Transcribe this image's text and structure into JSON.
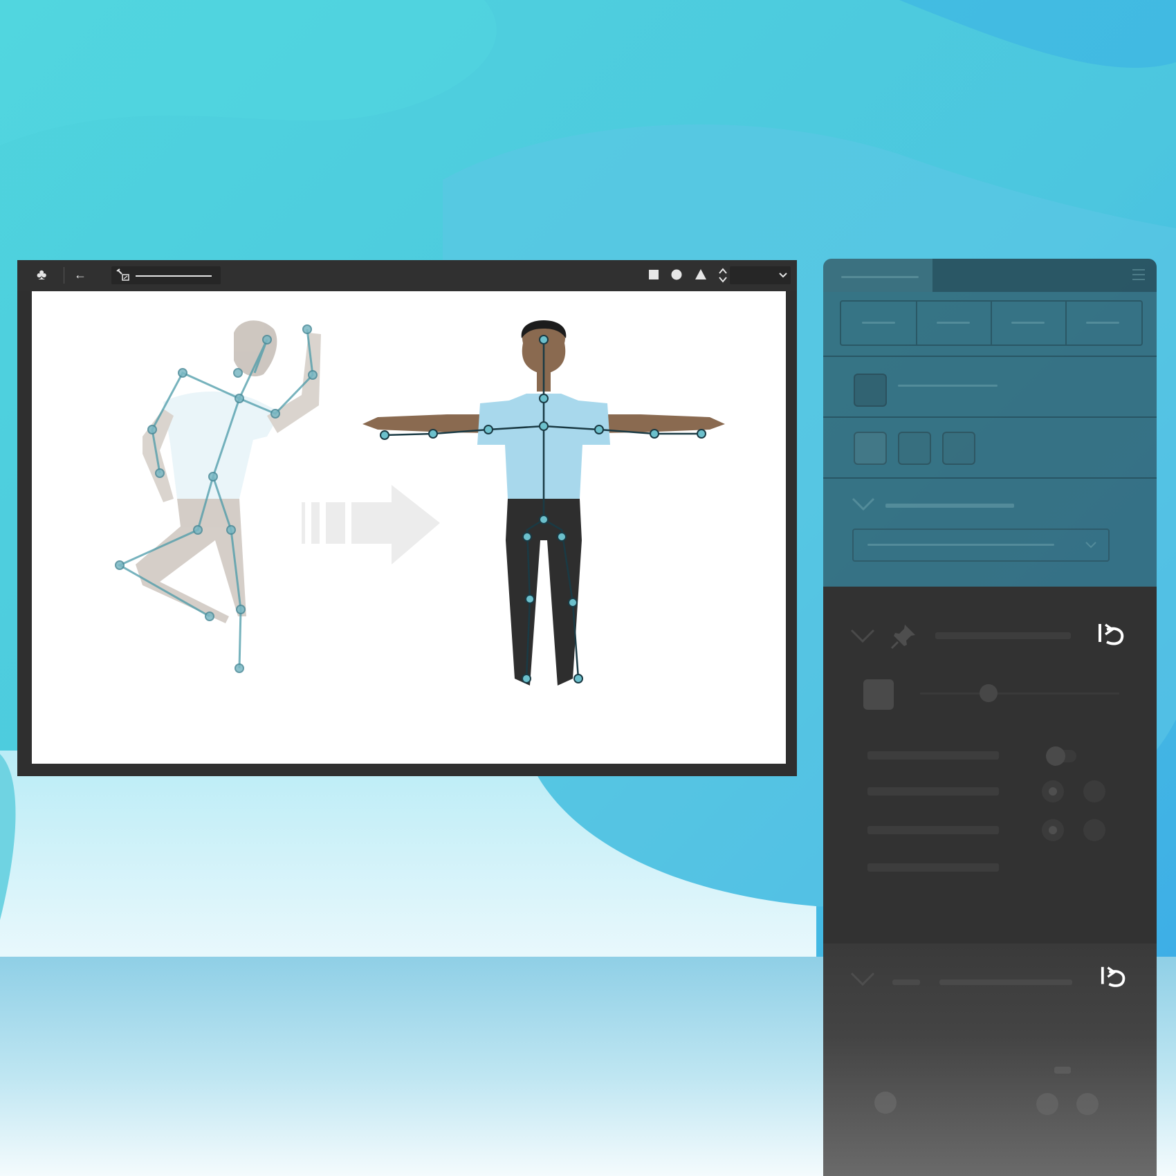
{
  "colors": {
    "accent": "#5fb8c8",
    "toolbar_bg": "#303030",
    "panel_dark": "#323232",
    "canvas_bg": "#ffffff"
  },
  "toolbar": {
    "icons": [
      "club-icon",
      "back-arrow-icon",
      "bone-tool-icon",
      "square-icon",
      "circle-icon",
      "triangle-icon",
      "stepper-icon",
      "chevron-down-icon"
    ]
  },
  "panels": {
    "icons": [
      "chevron-down-icon",
      "pin-icon",
      "reset-icon",
      "toggle-switch-icon",
      "radio-icon",
      "menu-icon"
    ]
  }
}
